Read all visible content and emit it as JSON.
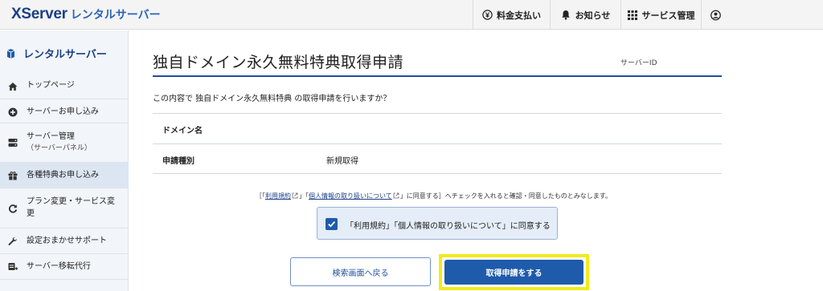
{
  "header": {
    "logo_main": "XServer",
    "logo_sub": "レンタルサーバー",
    "nav": [
      {
        "label": "料金支払い",
        "icon": "yen-icon"
      },
      {
        "label": "お知らせ",
        "icon": "bell-icon"
      },
      {
        "label": "サービス管理",
        "icon": "grid-icon"
      },
      {
        "label": "",
        "icon": "account-icon"
      }
    ]
  },
  "sidebar": {
    "title": "レンタルサーバー",
    "items": [
      {
        "label": "トップページ",
        "icon": "home-icon"
      },
      {
        "label": "サーバーお申し込み",
        "icon": "plus-circle-icon"
      },
      {
        "label": "サーバー管理",
        "sub": "（サーバーパネル）",
        "icon": "server-icon"
      },
      {
        "label": "各種特典お申し込み",
        "icon": "gift-icon",
        "active": true
      },
      {
        "label": "プラン変更・サービス変更",
        "icon": "refresh-icon"
      },
      {
        "label": "設定おまかせサポート",
        "icon": "wrench-icon"
      },
      {
        "label": "サーバー移転代行",
        "icon": "transfer-icon"
      }
    ]
  },
  "main": {
    "title": "独自ドメイン永久無料特典取得申請",
    "server_id_label": "サーバーID",
    "confirm_text": "この内容で 独自ドメイン永久無料特典 の取得申請を行いますか？",
    "rows": [
      {
        "key": "ドメイン名",
        "value": ""
      },
      {
        "key": "申請種別",
        "value": "新規取得"
      }
    ],
    "agree_note": {
      "open": "［「",
      "link1": "利用規約",
      "mid": "」「",
      "link2": "個人情報の取り扱いについて",
      "close": "」に同意する］へチェックを入れると確認・同意したものとみなします。"
    },
    "agree_checkbox_label": "「利用規約」「個人情報の取り扱いについて」に同意する",
    "agree_checked": true,
    "back_button": "検索画面へ戻る",
    "submit_button": "取得申請をする"
  },
  "colors": {
    "brand": "#1a3f86",
    "primary": "#1f5bab",
    "highlight": "#f2ea1d",
    "sidebar_bg": "#f2f5f9"
  }
}
